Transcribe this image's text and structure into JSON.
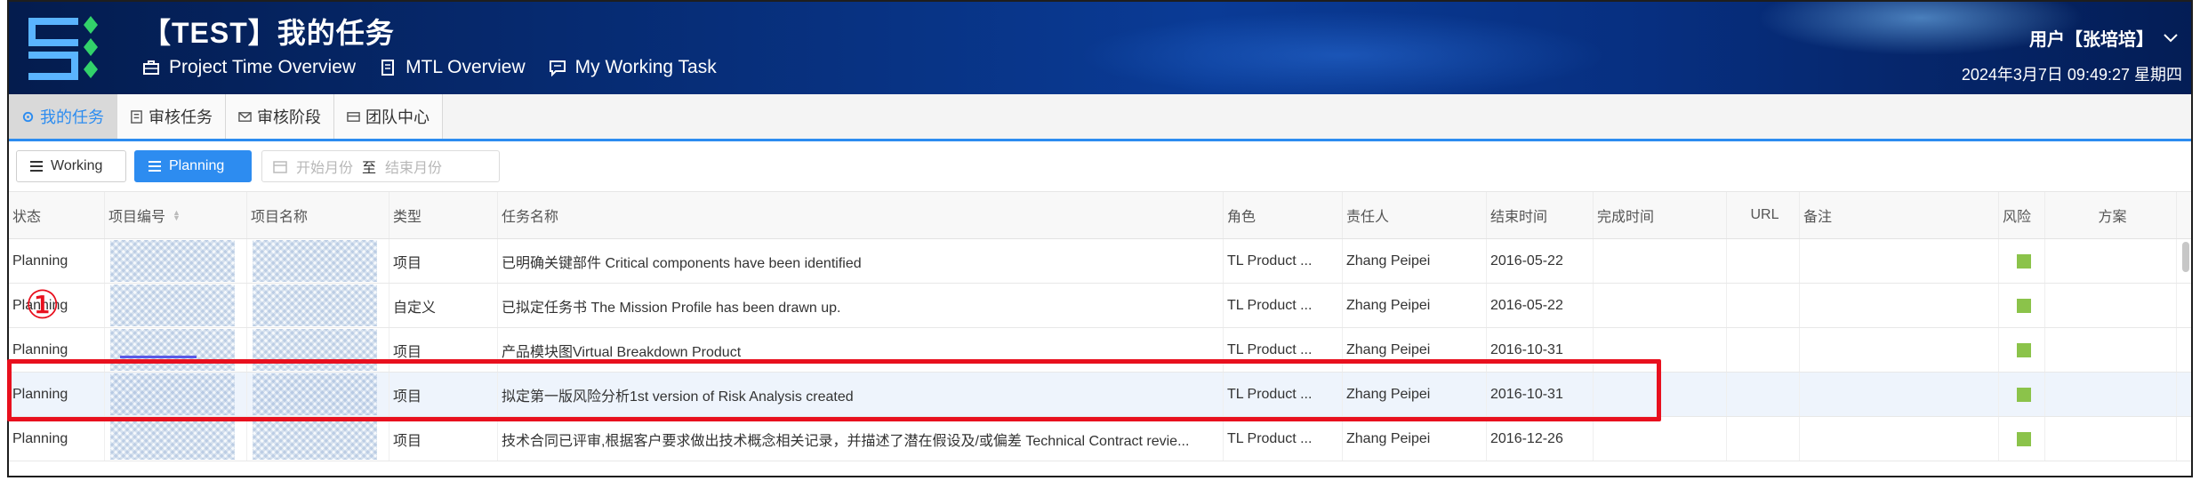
{
  "header": {
    "title": "【TEST】我的任务",
    "nav": [
      {
        "label": "Project Time Overview",
        "icon": "briefcase-icon"
      },
      {
        "label": "MTL Overview",
        "icon": "document-icon"
      },
      {
        "label": "My Working Task",
        "icon": "comment-icon"
      }
    ],
    "user": "用户【张培培】",
    "datetime": "2024年3月7日  09:49:27  星期四"
  },
  "tabs": [
    {
      "label": "我的任务",
      "active": true
    },
    {
      "label": "审核任务",
      "active": false
    },
    {
      "label": "审核阶段",
      "active": false
    },
    {
      "label": "团队中心",
      "active": false
    }
  ],
  "toolbar": {
    "working_label": "Working",
    "planning_label": "Planning",
    "start_placeholder": "开始月份",
    "separator": "至",
    "end_placeholder": "结束月份"
  },
  "table": {
    "columns": [
      "状态",
      "项目编号",
      "项目名称",
      "类型",
      "任务名称",
      "角色",
      "责任人",
      "结束时间",
      "完成时间",
      "URL",
      "备注",
      "风险",
      "方案"
    ],
    "rows": [
      {
        "status": "Planning",
        "type": "项目",
        "task": "已明确关键部件 Critical components have been identified",
        "role": "TL Product ...",
        "owner": "Zhang Peipei",
        "end": "2016-05-22"
      },
      {
        "status": "Planning",
        "type": "自定义",
        "task": "已拟定任务书 The Mission Profile has been drawn up.",
        "role": "TL Product ...",
        "owner": "Zhang Peipei",
        "end": "2016-05-22"
      },
      {
        "status": "Planning",
        "type": "项目",
        "task": "产品模块图Virtual Breakdown Product",
        "role": "TL Product ...",
        "owner": "Zhang Peipei",
        "end": "2016-10-31"
      },
      {
        "status": "Planning",
        "type": "项目",
        "task": "拟定第一版风险分析1st version of Risk Analysis created",
        "role": "TL Product ...",
        "owner": "Zhang Peipei",
        "end": "2016-10-31"
      },
      {
        "status": "Planning",
        "type": "项目",
        "task": "技术合同已评审,根据客户要求做出技术概念相关记录，并描述了潜在假设及/或偏差 Technical Contract revie...",
        "role": "TL Product ...",
        "owner": "Zhang Peipei",
        "end": "2016-12-26"
      }
    ]
  },
  "annotation": {
    "marker": "①"
  },
  "colors": {
    "accent": "#2d8cf0",
    "risk": "#8bc34a",
    "callout": "#e8101e",
    "header_bg": "#062a70"
  }
}
